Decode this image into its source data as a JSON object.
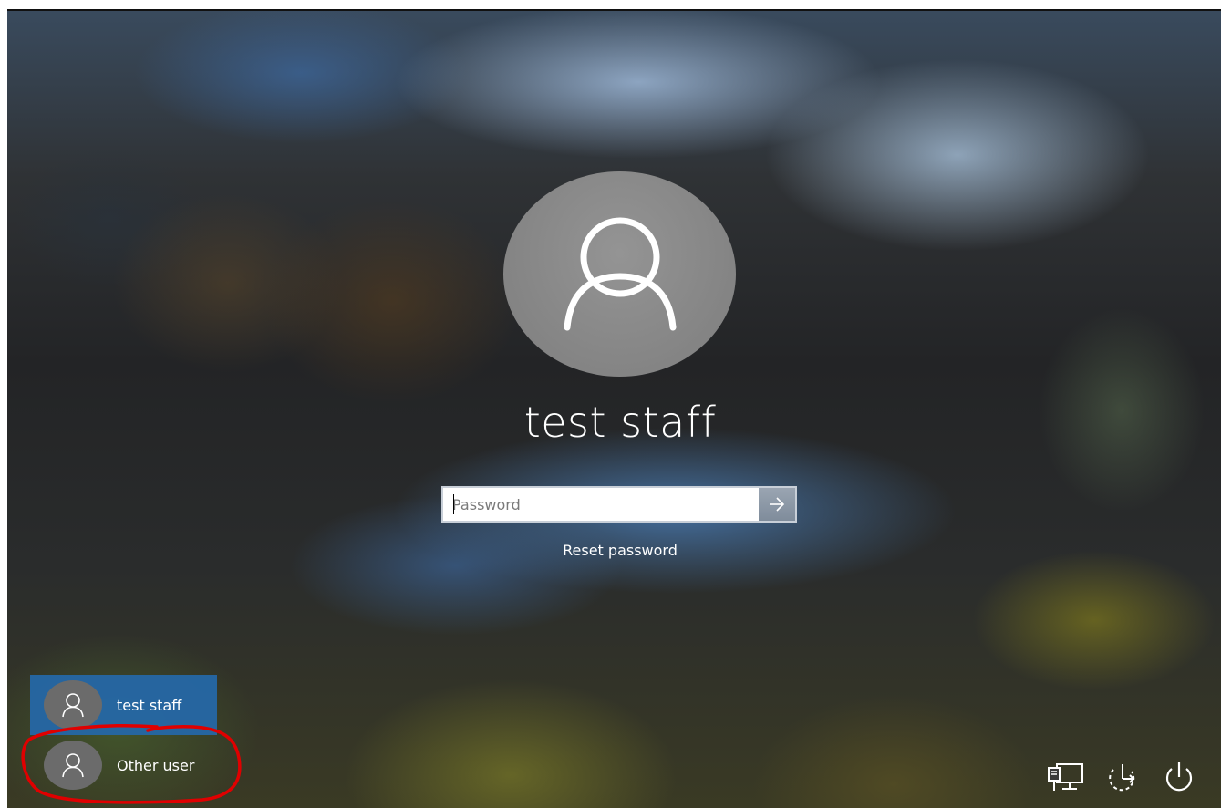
{
  "lock_screen": {
    "selected_user": {
      "name": "test staff",
      "avatar_icon": "person-icon"
    },
    "password_field": {
      "placeholder": "Password",
      "value": ""
    },
    "submit_icon": "arrow-right-icon",
    "reset_link": "Reset password"
  },
  "user_list": {
    "items": [
      {
        "label": "test staff",
        "icon": "person-icon",
        "selected": true
      },
      {
        "label": "Other user",
        "icon": "person-icon",
        "selected": false
      }
    ]
  },
  "system_tray": {
    "icons": [
      "network-icon",
      "ease-of-access-icon",
      "power-icon"
    ]
  },
  "colors": {
    "selected_user_bg": "#2567a5",
    "avatar_large_bg": "#8a8a8a",
    "avatar_small_bg": "#6b6b6b",
    "annotation_stroke": "#e00000"
  }
}
